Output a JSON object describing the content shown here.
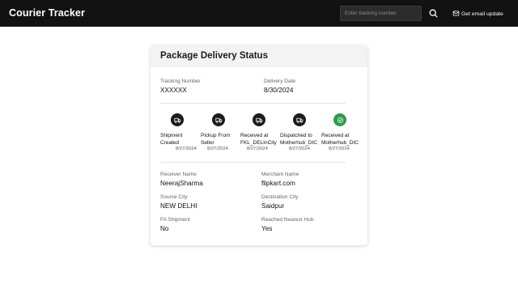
{
  "header": {
    "brand": "Courier Tracker",
    "search_placeholder": "Enter tracking number",
    "search_icon": "search-icon",
    "email_label": "Get email update",
    "email_icon": "mail-icon"
  },
  "card": {
    "title": "Package Delivery Status",
    "tracking_label": "Tracking Number",
    "tracking_value": "XXXXXX",
    "delivery_label": "Delivery Date",
    "delivery_value": "8/30/2024",
    "steps": [
      {
        "line1": "Shipment",
        "line2": "Created",
        "date": "8/27/2024",
        "icon": "truck-icon",
        "status": "pending"
      },
      {
        "line1": "Pickup From",
        "line2": "Seller",
        "date": "8/27/2024",
        "icon": "truck-icon",
        "status": "pending"
      },
      {
        "line1": "Received at",
        "line2": "FKL_DELInCity",
        "date": "8/27/2024",
        "icon": "truck-icon",
        "status": "pending"
      },
      {
        "line1": "Dispatched to",
        "line2": "Motherhub_DIC",
        "date": "8/27/2024",
        "icon": "truck-icon",
        "status": "pending"
      },
      {
        "line1": "Received at",
        "line2": "Motherhub_DIC",
        "date": "8/27/2024",
        "icon": "check-circle-icon",
        "status": "current"
      }
    ],
    "details": {
      "receiver_label": "Receiver Name",
      "receiver_value": "NeerajSharma",
      "merchant_label": "Merchant Name",
      "merchant_value": "flipkart.com",
      "source_label": "Source City",
      "source_value": "NEW DELHI",
      "destination_label": "Destination City",
      "destination_value": "Saidpur",
      "fa_label": "FA Shipment",
      "fa_value": "No",
      "hub_label": "Reached Nearest Hub",
      "hub_value": "Yes"
    }
  },
  "colors": {
    "topbar": "#121212",
    "step_dark": "#1c1c1c",
    "step_done": "#2e9b4c"
  }
}
